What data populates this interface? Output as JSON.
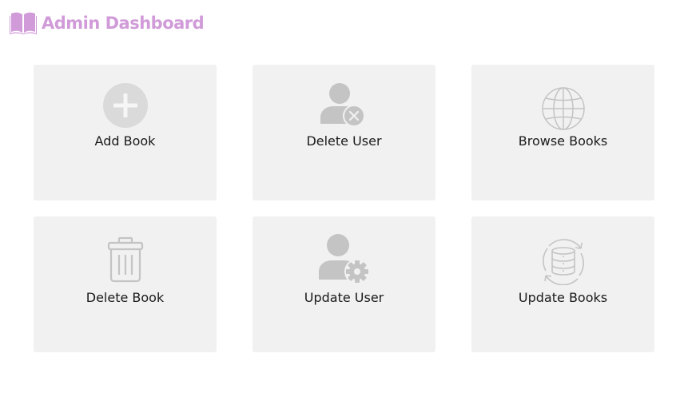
{
  "header": {
    "title": "Admin Dashboard",
    "logo_icon": "open-book-icon",
    "brand_color": "#d09bd8"
  },
  "cards": [
    {
      "label": "Add Book",
      "icon": "plus-circle-icon"
    },
    {
      "label": "Delete User",
      "icon": "user-remove-icon"
    },
    {
      "label": "Browse Books",
      "icon": "globe-icon"
    },
    {
      "label": "Delete Book",
      "icon": "trash-icon"
    },
    {
      "label": "Update User",
      "icon": "user-settings-icon"
    },
    {
      "label": "Update Books",
      "icon": "database-sync-icon"
    }
  ],
  "colors": {
    "card_background": "#f1f1f1",
    "icon_gray": "#c4c4c4",
    "text": "#1a1a1a"
  }
}
